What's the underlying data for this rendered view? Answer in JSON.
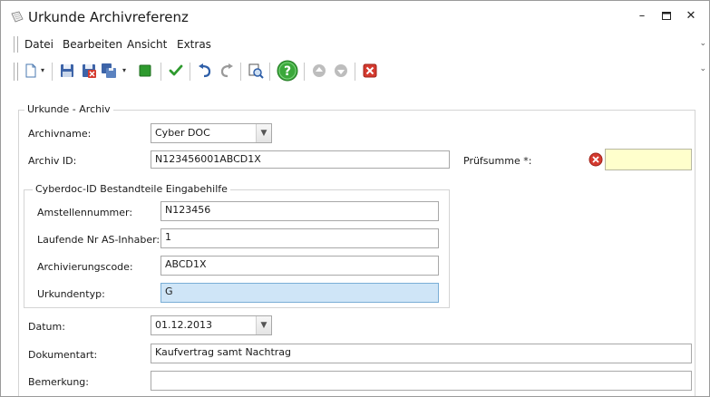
{
  "window": {
    "title": "Urkunde Archivreferenz",
    "minimize_glyph": "–",
    "maximize_glyph": "▫",
    "close_glyph": "✕"
  },
  "menu": {
    "items": [
      "Datei",
      "Bearbeiten",
      "Ansicht",
      "Extras"
    ]
  },
  "toolbar": {
    "icons": [
      "new-document-icon",
      "dropdown-arrow-icon",
      "save-icon",
      "save-close-icon",
      "save-copy-icon",
      "dropdown-arrow-icon",
      "green-square-icon",
      "checkmark-icon",
      "undo-icon",
      "redo-icon",
      "preview-icon",
      "help-icon",
      "move-up-icon",
      "move-down-icon",
      "delete-icon"
    ]
  },
  "form": {
    "group_title": "Urkunde - Archiv",
    "archivname_label": "Archivname:",
    "archivname_value": "Cyber DOC",
    "archiv_id_label": "Archiv ID:",
    "archiv_id_value": "N123456001ABCD1X",
    "pruefsumme_label": "Prüfsumme *:",
    "pruefsumme_value": "",
    "subgroup_title": "Cyberdoc-ID Bestandteile Eingabehilfe",
    "amstellennummer_label": "Amstellennummer:",
    "amstellennummer_value": "N123456",
    "laufende_nr_label": "Laufende Nr AS-Inhaber:",
    "laufende_nr_value": "1",
    "archivierungscode_label": "Archivierungscode:",
    "archivierungscode_value": "ABCD1X",
    "urkundentyp_label": "Urkundentyp:",
    "urkundentyp_value": "G",
    "datum_label": "Datum:",
    "datum_value": "01.12.2013",
    "dokumentart_label": "Dokumentart:",
    "dokumentart_value": "Kaufvertrag samt Nachtrag",
    "bemerkung_label": "Bemerkung:",
    "bemerkung_value": ""
  },
  "colors": {
    "accent_green": "#2e9a2e",
    "error_red": "#d43a2f",
    "highlight_blue": "#cfe5f7",
    "required_yellow": "#ffffcc"
  }
}
